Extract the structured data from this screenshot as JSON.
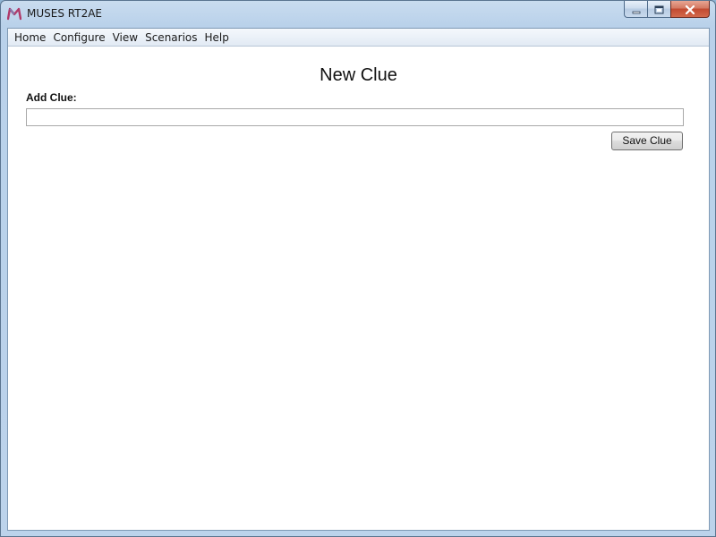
{
  "window": {
    "title": "MUSES RT2AE",
    "icon": "muses-m-logo-icon",
    "accent_color": "#c0392b"
  },
  "menu": {
    "items": [
      {
        "label": "Home"
      },
      {
        "label": "Configure"
      },
      {
        "label": "View"
      },
      {
        "label": "Scenarios"
      },
      {
        "label": "Help"
      }
    ]
  },
  "main": {
    "title": "New Clue",
    "add_clue_label": "Add Clue:",
    "clue_input_value": "",
    "save_button_label": "Save Clue"
  }
}
